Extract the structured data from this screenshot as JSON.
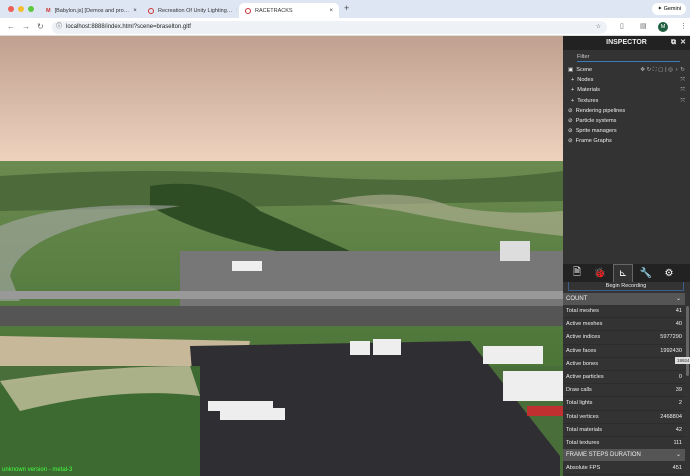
{
  "browser": {
    "tabs": [
      {
        "label": "[Babylon.js] [Demos and pro…"
      },
      {
        "label": "Recreation Of Unity Lighting…"
      },
      {
        "label": "RACETRACKS"
      }
    ],
    "new_tab": "+",
    "gemini": "Gemini",
    "url": "localhost:8888/index.html?scene=braselton.gltf",
    "profile": "M"
  },
  "inspector": {
    "title": "INSPECTOR",
    "filter_placeholder": "Filter",
    "scene_label": "Scene",
    "tree": [
      {
        "label": "Nodes",
        "icon": "plus"
      },
      {
        "label": "Materials",
        "icon": "plus"
      },
      {
        "label": "Textures",
        "icon": "plus"
      },
      {
        "label": "Rendering pipelines",
        "icon": "ban"
      },
      {
        "label": "Particle systems",
        "icon": "ban"
      },
      {
        "label": "Sprite managers",
        "icon": "ban"
      },
      {
        "label": "Frame Graphs",
        "icon": "ban"
      }
    ],
    "begin_recording": "Begin Recording",
    "count_header": "COUNT",
    "stats": [
      {
        "label": "Total meshes",
        "value": "41"
      },
      {
        "label": "Active meshes",
        "value": "40"
      },
      {
        "label": "Active indices",
        "value": "5977290"
      },
      {
        "label": "Active faces",
        "value": "1992430"
      },
      {
        "label": "Active bones",
        "value": ""
      },
      {
        "label": "Active particles",
        "value": "0"
      },
      {
        "label": "Draw calls",
        "value": "39"
      },
      {
        "label": "Total lights",
        "value": "2"
      },
      {
        "label": "Total vertices",
        "value": "2468804"
      },
      {
        "label": "Total materials",
        "value": "42"
      },
      {
        "label": "Total textures",
        "value": "111"
      }
    ],
    "tooltip": "19924",
    "frame_header": "FRAME STEPS DURATION",
    "fps": {
      "label": "Absolute FPS",
      "value": "451"
    }
  },
  "version": "unknown version - metal-3"
}
